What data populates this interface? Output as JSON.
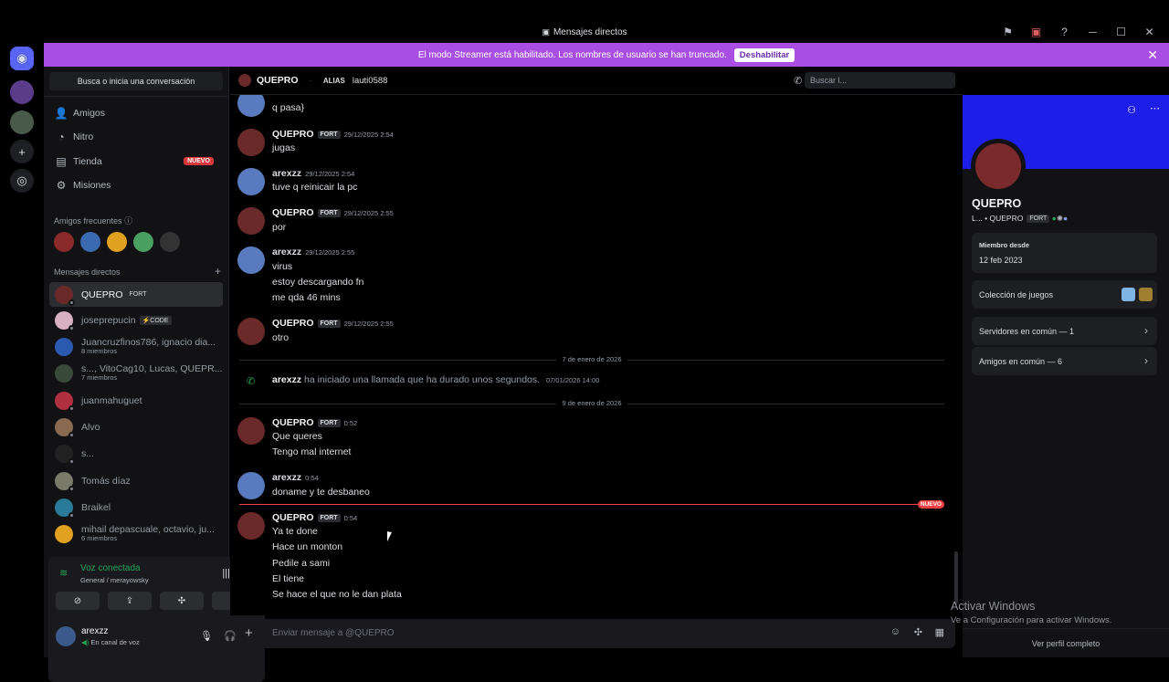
{
  "window": {
    "title": "Mensajes directos"
  },
  "titlebar_icons": [
    "flag-icon",
    "screen-icon",
    "help-icon",
    "minimize-icon",
    "maximize-icon",
    "close-icon"
  ],
  "banner": {
    "text": "El modo Streamer está habilitado. Los nombres de usuario se han truncado.",
    "button": "Deshabilitar"
  },
  "sidebar": {
    "search": "Busca o inicia una conversación",
    "nav": [
      {
        "label": "Amigos",
        "icon": "friends-icon"
      },
      {
        "label": "Nitro",
        "icon": "nitro-icon"
      },
      {
        "label": "Tienda",
        "icon": "shop-icon",
        "badge": "NUEVO"
      },
      {
        "label": "Misiones",
        "icon": "quests-icon"
      }
    ],
    "frequent_title": "Amigos frecuentes",
    "dm_title": "Mensajes directos",
    "dms": [
      {
        "name": "QUEPRO",
        "tag": "FORT",
        "active": true
      },
      {
        "name": "joseprepucin",
        "tag": "⚡CODE"
      },
      {
        "name": "Juancruzfinos786, ignacio dia...",
        "sub": "8 miembros"
      },
      {
        "name": "s..., VitoCag10, Lucas, QUEPR...",
        "sub": "7 miembros"
      },
      {
        "name": "juanmahuguet"
      },
      {
        "name": "Alvo"
      },
      {
        "name": "s..."
      },
      {
        "name": "Tomás díaz"
      },
      {
        "name": "Braikel"
      },
      {
        "name": "mihail depascuale, octavio, ju...",
        "sub": "6 miembros"
      }
    ],
    "voice": {
      "title": "Voz conectada",
      "sub": "General / merayowsky"
    },
    "user": {
      "name": "arexzz",
      "status": "En canal de voz"
    }
  },
  "chat_header": {
    "name": "QUEPRO",
    "alias_label": "ALIAS",
    "alias": "lauti0588",
    "search": "Buscar l..."
  },
  "messages": [
    {
      "lines": [
        "q pasa}"
      ]
    },
    {
      "author": "QUEPRO",
      "tag": "FORT",
      "time": "29/12/2025 2:54",
      "lines": [
        "jugas"
      ]
    },
    {
      "author": "arexzz",
      "time": "29/12/2025 2:54",
      "lines": [
        "tuve q reinicair la pc"
      ]
    },
    {
      "author": "QUEPRO",
      "tag": "FORT",
      "time": "29/12/2025 2:55",
      "lines": [
        "por"
      ]
    },
    {
      "author": "arexzz",
      "time": "29/12/2025 2:55",
      "lines": [
        "virus",
        "estoy descargando fn",
        "me qda 46 mins"
      ]
    },
    {
      "author": "QUEPRO",
      "tag": "FORT",
      "time": "29/12/2025 2:55",
      "lines": [
        "otro"
      ]
    },
    {
      "author": "QUEPRO",
      "tag": "FORT",
      "time": "0:52",
      "lines": [
        "Que queres",
        "Tengo mal internet"
      ]
    },
    {
      "author": "arexzz",
      "time": "0:54",
      "lines": [
        "doname y te desbaneo"
      ]
    },
    {
      "author": "QUEPRO",
      "tag": "FORT",
      "time": "0:54",
      "lines": [
        "Ya te done",
        "Hace un monton",
        "Pedile a sami",
        "El tiene",
        "Se hace el que no le dan plata"
      ]
    }
  ],
  "dividers": [
    "7 de enero de 2026",
    "9 de enero de 2026"
  ],
  "call": {
    "author": "arexzz",
    "text": "ha iniciado una llamada que ha durado unos segundos.",
    "time": "07/01/2026 14:00"
  },
  "new_badge": "NUEVO",
  "input_placeholder": "Enviar mensaje a @QUEPRO",
  "profile": {
    "name": "QUEPRO",
    "sub": "L... • QUEPRO",
    "tag": "FORT",
    "member_since_label": "Miembro desde",
    "member_since": "12 feb 2023",
    "games": "Colección de juegos",
    "servers": "Servidores en común — 1",
    "friends": "Amigos en común — 6",
    "full": "Ver perfil completo"
  },
  "watermark": {
    "title": "Activar Windows",
    "sub": "Ve a Configuración para activar Windows."
  },
  "colors": {
    "banner": "#a94ee3",
    "profile_banner": "#1d1ee8",
    "online": "#23a55a",
    "new": "#f23f43"
  }
}
